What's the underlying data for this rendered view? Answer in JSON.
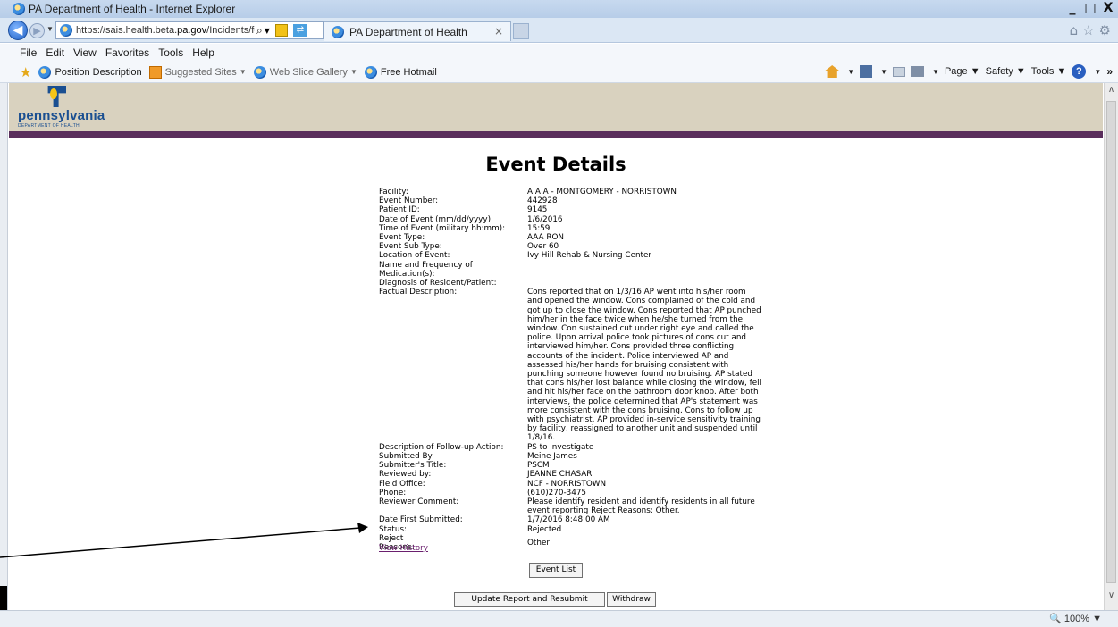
{
  "window": {
    "title": "PA Department of Health - Internet Explorer",
    "controls": [
      "_",
      "□",
      "X"
    ]
  },
  "nav": {
    "url_prefix": "https://sais.health.beta.",
    "url_domain": "pa.gov",
    "url_suffix": "/Incidents/form_ResubmitIn",
    "tab_label": "PA Department of Health",
    "tab_close": "×"
  },
  "menu": [
    "File",
    "Edit",
    "View",
    "Favorites",
    "Tools",
    "Help"
  ],
  "favorites": {
    "items": [
      {
        "label": "Position Description",
        "dropdown": false,
        "grey": false,
        "icon": "ie-icon"
      },
      {
        "label": "Suggested Sites",
        "dropdown": true,
        "grey": true,
        "icon": "suggested-sites-icon"
      },
      {
        "label": "Web Slice Gallery",
        "dropdown": true,
        "grey": true,
        "icon": "ie-icon"
      },
      {
        "label": "Free Hotmail",
        "dropdown": false,
        "grey": false,
        "icon": "ie-icon"
      }
    ]
  },
  "command_bar": {
    "page": "Page",
    "safety": "Safety",
    "tools": "Tools"
  },
  "header": {
    "logo_text": "pennsylvania",
    "logo_sub": "DEPARTMENT OF HEALTH"
  },
  "page": {
    "title": "Event Details",
    "view_history": "View History"
  },
  "details": [
    {
      "label": "Facility:",
      "value": "A A A - MONTGOMERY - NORRISTOWN"
    },
    {
      "label": "Event Number:",
      "value": "442928"
    },
    {
      "label": "Patient ID:",
      "value": "9145"
    },
    {
      "label": "Date of Event (mm/dd/yyyy):",
      "value": "1/6/2016"
    },
    {
      "label": "Time of Event (military hh:mm):",
      "value": "15:59"
    },
    {
      "label": "Event Type:",
      "value": "AAA RON"
    },
    {
      "label": "Event Sub Type:",
      "value": "Over 60"
    },
    {
      "label": "Location of Event:",
      "value": "Ivy Hill Rehab & Nursing Center"
    },
    {
      "label": "Name and Frequency of Medication(s):",
      "value": ""
    },
    {
      "label": "Diagnosis of Resident/Patient:",
      "value": ""
    },
    {
      "label": "Factual Description:",
      "value": "Cons reported that on 1/3/16 AP went into his/her room and opened the window. Cons complained of the cold and got up to close the window. Cons reported that AP punched him/her in the face twice when he/she turned from the window. Con sustained cut under right eye and called the police. Upon arrival police took pictures of cons cut and interviewed him/her. Cons provided three conflicting accounts of the incident. Police interviewed AP and assessed his/her hands for bruising consistent with punching someone however found no bruising. AP stated that cons his/her lost balance while closing the window, fell and hit his/her face on the bathroom door knob. After both interviews, the police determined that AP's statement was more consistent with the cons bruising. Cons to follow up with psychiatrist. AP provided in-service sensitivity training by facility, reassigned to another unit and suspended until 1/8/16."
    },
    {
      "label": "Description of Follow-up Action:",
      "value": "PS to investigate"
    },
    {
      "label": "Submitted By:",
      "value": "Meine James"
    },
    {
      "label": "Submitter's Title:",
      "value": "PSCM"
    },
    {
      "label": "Reviewed by:",
      "value": "JEANNE CHASAR"
    },
    {
      "label": "Field Office:",
      "value": "NCF - NORRISTOWN"
    },
    {
      "label": "Phone:",
      "value": "(610)270-3475"
    },
    {
      "label": "Reviewer Comment:",
      "value": "Please identify resident and identify residents in all future event reporting Reject Reasons: Other."
    },
    {
      "label": "Date First Submitted:",
      "value": "1/7/2016 8:48:00 AM"
    },
    {
      "label": "Status:",
      "value": "Rejected"
    },
    {
      "label": "Reject Reasons:",
      "value": "Other"
    }
  ],
  "buttons": {
    "event_list": "Event List",
    "update_resubmit": "Update Report and Resubmit",
    "withdraw": "Withdraw"
  },
  "status_bar": {
    "zoom": "100%"
  }
}
